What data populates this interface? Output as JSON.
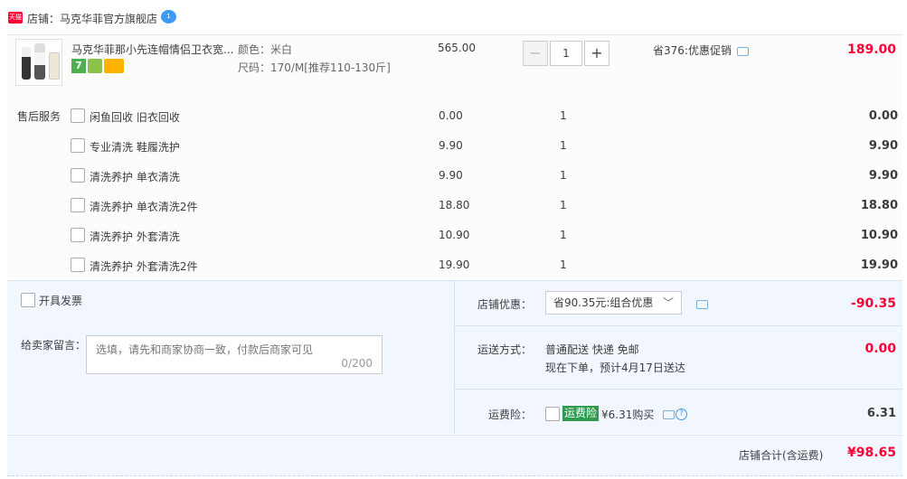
{
  "store": {
    "badge": "天猫",
    "label": "店铺：马克华菲官方旗舰店",
    "chat_badge": "1"
  },
  "item": {
    "title": "马克华菲那小先连帽情侣卫衣宽...",
    "promo_badge_7": "7",
    "color": "颜色：米白",
    "size": "尺码：170/M[推荐110-130斤]",
    "price": "565.00",
    "qty_minus": "−",
    "qty": "1",
    "qty_plus": "+",
    "discount": "省376:优惠促销",
    "subtotal": "189.00"
  },
  "services": {
    "heading": "售后服务",
    "rows": [
      {
        "name": "闲鱼回收 旧衣回收",
        "price": "0.00",
        "qty": "1",
        "total": "0.00"
      },
      {
        "name": "专业清洗 鞋履洗护",
        "price": "9.90",
        "qty": "1",
        "total": "9.90"
      },
      {
        "name": "清洗养护 单衣清洗",
        "price": "9.90",
        "qty": "1",
        "total": "9.90"
      },
      {
        "name": "清洗养护 单衣清洗2件",
        "price": "18.80",
        "qty": "1",
        "total": "18.80"
      },
      {
        "name": "清洗养护 外套清洗",
        "price": "10.90",
        "qty": "1",
        "total": "10.90"
      },
      {
        "name": "清洗养护 外套清洗2件",
        "price": "19.90",
        "qty": "1",
        "total": "19.90"
      }
    ]
  },
  "order": {
    "invoice_label": "开具发票",
    "message_label": "给卖家留言：",
    "message_placeholder": "选填，请先和商家协商一致，付款后商家可见",
    "message_count": "0/200",
    "shop_discount_label": "店铺优惠：",
    "shop_discount_value": "省90.35元:组合优惠",
    "shop_discount_amount": "-90.35",
    "shipping_label": "运送方式：",
    "shipping_line1": "普通配送 快递 免邮",
    "shipping_line2": "现在下单，预计4月17日送达",
    "shipping_amount": "0.00",
    "insurance_label": "运费险：",
    "insurance_badge": "运费险",
    "insurance_text": "¥6.31购买",
    "insurance_amount": "6.31"
  },
  "total": {
    "label": "店铺合计(含运费)",
    "amount": "¥98.65"
  },
  "colors": {
    "accent_red": "#ff0036",
    "panel_blue": "#f2f7ff",
    "insurance_green": "#2e9b4f"
  }
}
